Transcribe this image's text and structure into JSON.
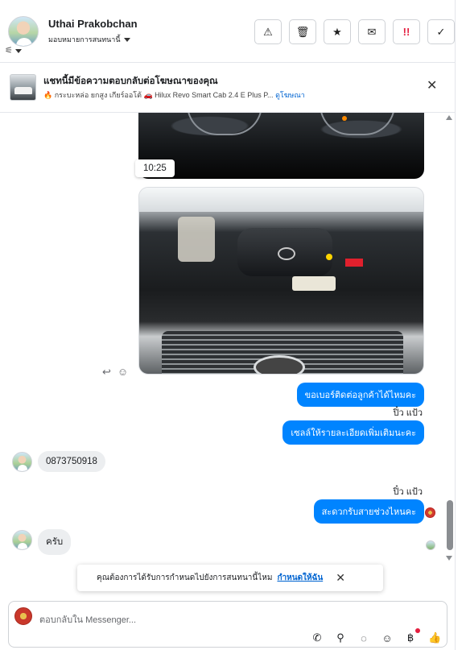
{
  "header": {
    "name": "Uthai Prakobchan",
    "assign_label": "มอบหมายการสนทนานี้",
    "actions": [
      {
        "icon": "warning-icon",
        "glyph": "⚠"
      },
      {
        "icon": "trash-icon",
        "glyph": "🗑"
      },
      {
        "icon": "star-icon",
        "glyph": "★"
      },
      {
        "icon": "mark-unread-icon",
        "glyph": "✉"
      },
      {
        "icon": "urgent-icon",
        "glyph": "!!"
      },
      {
        "icon": "check-icon",
        "glyph": "✓"
      }
    ]
  },
  "banner": {
    "title": "แชทนี้มีข้อความตอบกลับต่อโฆษณาของคุณ",
    "subtitle": "🔥 กระบะหล่อ ยกสูง เกียร์ออโต้ 🚗 Hilux Revo Smart Cab 2.4 E Plus P...",
    "link": "ดูโฆษณา"
  },
  "chat": {
    "timestamp": "10:25",
    "messages": [
      {
        "direction": "out",
        "text": "ขอเบอร์ติดต่อลูกค้าได้ไหมคะ"
      },
      {
        "direction": "sender",
        "text": "ปิ๋ว แป้ว"
      },
      {
        "direction": "out",
        "text": "เซลล์ให้รายละเอียดเพิ่มเติมนะคะ"
      },
      {
        "direction": "in",
        "text": "0873750918"
      },
      {
        "direction": "sender",
        "text": "ปิ๋ว แป้ว"
      },
      {
        "direction": "out",
        "text": "สะดวกรับสายช่วงไหนคะ"
      },
      {
        "direction": "in",
        "text": "ครับ"
      }
    ]
  },
  "toast": {
    "text": "คุณต้องการได้รับการกำหนดไปยังการสนทนานี้ไหม",
    "link": "กำหนดให้ฉัน"
  },
  "composer": {
    "placeholder": "ตอบกลับใน Messenger..."
  }
}
